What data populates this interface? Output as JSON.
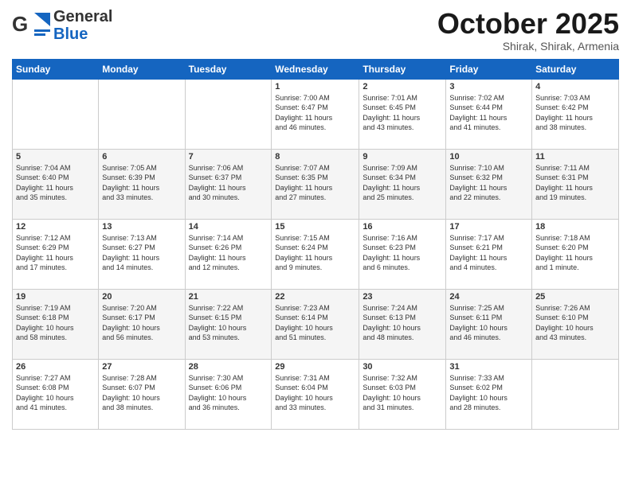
{
  "header": {
    "logo_general": "General",
    "logo_blue": "Blue",
    "month_title": "October 2025",
    "location": "Shirak, Shirak, Armenia"
  },
  "days_of_week": [
    "Sunday",
    "Monday",
    "Tuesday",
    "Wednesday",
    "Thursday",
    "Friday",
    "Saturday"
  ],
  "weeks": [
    [
      {
        "day": "",
        "info": ""
      },
      {
        "day": "",
        "info": ""
      },
      {
        "day": "",
        "info": ""
      },
      {
        "day": "1",
        "info": "Sunrise: 7:00 AM\nSunset: 6:47 PM\nDaylight: 11 hours\nand 46 minutes."
      },
      {
        "day": "2",
        "info": "Sunrise: 7:01 AM\nSunset: 6:45 PM\nDaylight: 11 hours\nand 43 minutes."
      },
      {
        "day": "3",
        "info": "Sunrise: 7:02 AM\nSunset: 6:44 PM\nDaylight: 11 hours\nand 41 minutes."
      },
      {
        "day": "4",
        "info": "Sunrise: 7:03 AM\nSunset: 6:42 PM\nDaylight: 11 hours\nand 38 minutes."
      }
    ],
    [
      {
        "day": "5",
        "info": "Sunrise: 7:04 AM\nSunset: 6:40 PM\nDaylight: 11 hours\nand 35 minutes."
      },
      {
        "day": "6",
        "info": "Sunrise: 7:05 AM\nSunset: 6:39 PM\nDaylight: 11 hours\nand 33 minutes."
      },
      {
        "day": "7",
        "info": "Sunrise: 7:06 AM\nSunset: 6:37 PM\nDaylight: 11 hours\nand 30 minutes."
      },
      {
        "day": "8",
        "info": "Sunrise: 7:07 AM\nSunset: 6:35 PM\nDaylight: 11 hours\nand 27 minutes."
      },
      {
        "day": "9",
        "info": "Sunrise: 7:09 AM\nSunset: 6:34 PM\nDaylight: 11 hours\nand 25 minutes."
      },
      {
        "day": "10",
        "info": "Sunrise: 7:10 AM\nSunset: 6:32 PM\nDaylight: 11 hours\nand 22 minutes."
      },
      {
        "day": "11",
        "info": "Sunrise: 7:11 AM\nSunset: 6:31 PM\nDaylight: 11 hours\nand 19 minutes."
      }
    ],
    [
      {
        "day": "12",
        "info": "Sunrise: 7:12 AM\nSunset: 6:29 PM\nDaylight: 11 hours\nand 17 minutes."
      },
      {
        "day": "13",
        "info": "Sunrise: 7:13 AM\nSunset: 6:27 PM\nDaylight: 11 hours\nand 14 minutes."
      },
      {
        "day": "14",
        "info": "Sunrise: 7:14 AM\nSunset: 6:26 PM\nDaylight: 11 hours\nand 12 minutes."
      },
      {
        "day": "15",
        "info": "Sunrise: 7:15 AM\nSunset: 6:24 PM\nDaylight: 11 hours\nand 9 minutes."
      },
      {
        "day": "16",
        "info": "Sunrise: 7:16 AM\nSunset: 6:23 PM\nDaylight: 11 hours\nand 6 minutes."
      },
      {
        "day": "17",
        "info": "Sunrise: 7:17 AM\nSunset: 6:21 PM\nDaylight: 11 hours\nand 4 minutes."
      },
      {
        "day": "18",
        "info": "Sunrise: 7:18 AM\nSunset: 6:20 PM\nDaylight: 11 hours\nand 1 minute."
      }
    ],
    [
      {
        "day": "19",
        "info": "Sunrise: 7:19 AM\nSunset: 6:18 PM\nDaylight: 10 hours\nand 58 minutes."
      },
      {
        "day": "20",
        "info": "Sunrise: 7:20 AM\nSunset: 6:17 PM\nDaylight: 10 hours\nand 56 minutes."
      },
      {
        "day": "21",
        "info": "Sunrise: 7:22 AM\nSunset: 6:15 PM\nDaylight: 10 hours\nand 53 minutes."
      },
      {
        "day": "22",
        "info": "Sunrise: 7:23 AM\nSunset: 6:14 PM\nDaylight: 10 hours\nand 51 minutes."
      },
      {
        "day": "23",
        "info": "Sunrise: 7:24 AM\nSunset: 6:13 PM\nDaylight: 10 hours\nand 48 minutes."
      },
      {
        "day": "24",
        "info": "Sunrise: 7:25 AM\nSunset: 6:11 PM\nDaylight: 10 hours\nand 46 minutes."
      },
      {
        "day": "25",
        "info": "Sunrise: 7:26 AM\nSunset: 6:10 PM\nDaylight: 10 hours\nand 43 minutes."
      }
    ],
    [
      {
        "day": "26",
        "info": "Sunrise: 7:27 AM\nSunset: 6:08 PM\nDaylight: 10 hours\nand 41 minutes."
      },
      {
        "day": "27",
        "info": "Sunrise: 7:28 AM\nSunset: 6:07 PM\nDaylight: 10 hours\nand 38 minutes."
      },
      {
        "day": "28",
        "info": "Sunrise: 7:30 AM\nSunset: 6:06 PM\nDaylight: 10 hours\nand 36 minutes."
      },
      {
        "day": "29",
        "info": "Sunrise: 7:31 AM\nSunset: 6:04 PM\nDaylight: 10 hours\nand 33 minutes."
      },
      {
        "day": "30",
        "info": "Sunrise: 7:32 AM\nSunset: 6:03 PM\nDaylight: 10 hours\nand 31 minutes."
      },
      {
        "day": "31",
        "info": "Sunrise: 7:33 AM\nSunset: 6:02 PM\nDaylight: 10 hours\nand 28 minutes."
      },
      {
        "day": "",
        "info": ""
      }
    ]
  ]
}
